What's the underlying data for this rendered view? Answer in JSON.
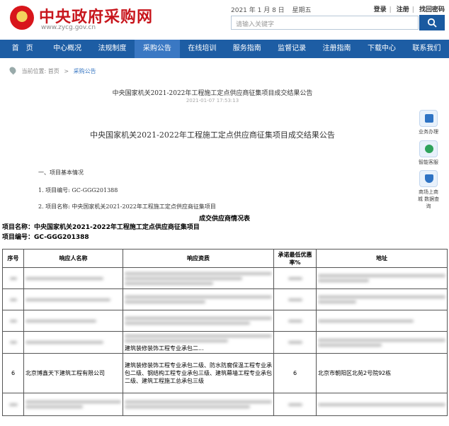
{
  "header": {
    "site_title": "中央政府采购网",
    "site_url": "www.zycg.gov.cn",
    "date": "2021 年 1 月 8 日",
    "weekday": "星期五",
    "auth": [
      "登录",
      "注册",
      "找回密码"
    ],
    "search_placeholder": "请输入关键字"
  },
  "nav": [
    "首　页",
    "中心概况",
    "法规制度",
    "采购公告",
    "在线培训",
    "服务指南",
    "监督记录",
    "注册指南",
    "下载中心",
    "联系我们"
  ],
  "breadcrumb": {
    "label": "当前位置:",
    "home": "首页",
    "sep": ">",
    "current": "采购公告"
  },
  "article": {
    "title": "中央国家机关2021-2022年工程施工定点供应商征集项目成交结果公告",
    "meta": "2021-01-07 17:53:13",
    "heading": "中央国家机关2021-2022年工程施工定点供应商征集项目成交结果公告",
    "section1": "一、项目基本情况",
    "item1": "1. 项目编号: GC-GGG201388",
    "item2": "2. 项目名称: 中央国家机关2021-2022年工程施工定点供应商征集项目"
  },
  "side": [
    "业务办理",
    "智能客服",
    "商场上商城 数据查询"
  ],
  "table": {
    "caption": "成交供应商情况表",
    "project_name": "项目名称：中央国家机关2021-2022年工程施工定点供应商征集项目",
    "project_no": "项目编号：GC-GGG201388",
    "headers": [
      "序号",
      "响应人名称",
      "响应资质",
      "承诺最低优惠率%",
      "地址"
    ],
    "row": {
      "no": "6",
      "name": "北京博鑫天下建筑工程有限公司",
      "qual": "建筑装修装饰工程专业承包二级、防水防腐保温工程专业承包二级、钢结构工程专业承包三级、建筑幕墙工程专业承包二级、建筑工程施工总承包三级",
      "rate": "6",
      "addr": "北京市朝阳区北苑2号院92栋"
    },
    "row5_partial": "建筑装修装饰工程专业承包二..."
  }
}
